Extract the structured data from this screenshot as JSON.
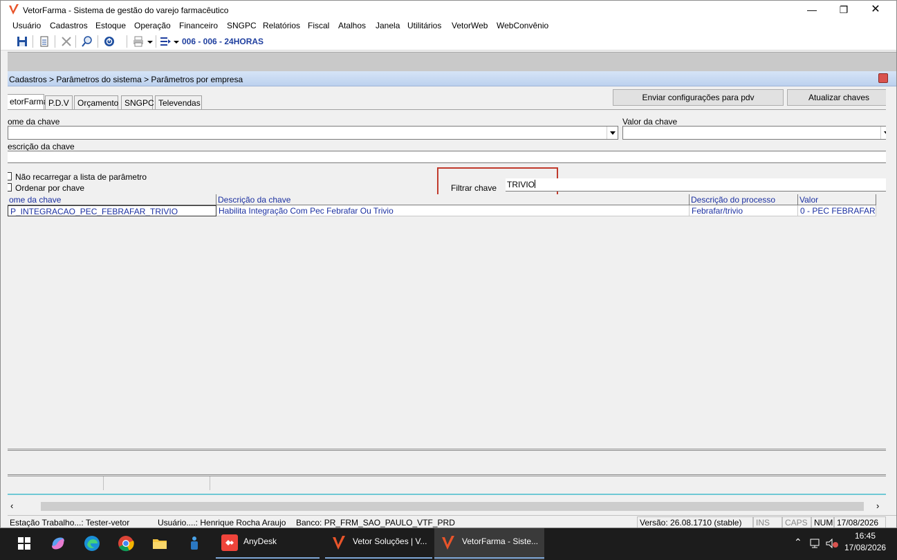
{
  "window": {
    "title": "VetorFarma - Sistema de gestão do varejo farmacêutico"
  },
  "menu": [
    "Usuário",
    "Cadastros",
    "Estoque",
    "Operação",
    "Financeiro",
    "SNGPC",
    "Relatórios",
    "Fiscal",
    "Atalhos",
    "Janela",
    "Utilitários",
    "VetorWeb",
    "WebConvênio"
  ],
  "toolbar": {
    "store_label": "006 - 006 - 24HORAS"
  },
  "breadcrumb": "Cadastros > Parâmetros do sistema > Parâmetros por empresa",
  "tabs": [
    "etorFarma",
    "P.D.V",
    "Orçamento",
    "SNGPC",
    "Televendas"
  ],
  "actions": {
    "send_pdv": "Enviar configurações para  pdv",
    "update_keys": "Atualizar chaves"
  },
  "form": {
    "key_name_label": "ome da chave",
    "key_name_value": "",
    "key_value_label": "Valor da chave",
    "key_value_value": "",
    "key_desc_label": "escrição da chave",
    "key_desc_value": "",
    "no_reload_label": "Não recarregar a lista de parâmetro",
    "order_by_key_label": "Ordenar por chave",
    "filter_label": "Filtrar chave",
    "filter_value": "TRIVIO"
  },
  "grid": {
    "columns": [
      "ome da chave",
      "Descrição  da chave",
      "Descrição do processo",
      "Valor"
    ],
    "rows": [
      [
        "P_INTEGRACAO_PEC_FEBRAFAR_TRIVIO",
        "Habilita Integração Com Pec Febrafar Ou Trivio",
        "Febrafar/trivio",
        "0 - PEC FEBRAFAR"
      ]
    ]
  },
  "statusbar": {
    "station": "Estação Trabalho...:  Tester-vetor",
    "user": "Usuário....: Henrique Rocha Araujo",
    "bank": "Banco: PR_FRM_SAO_PAULO_VTF_PRD",
    "version": "Versão: 26.08.1710 (stable)",
    "ins": "INS",
    "caps": "CAPS",
    "num": "NUM",
    "date": "17/08/2026"
  },
  "taskbar": {
    "items": [
      "AnyDesk",
      "Vetor Soluções  |  V...",
      "VetorFarma - Siste..."
    ],
    "time": "16:45",
    "date": "17/08/2026"
  },
  "colors": {
    "accent_red": "#c0392b",
    "grid_text": "#1a2fa0",
    "breadcrumb_bar": "#c8daf2"
  }
}
